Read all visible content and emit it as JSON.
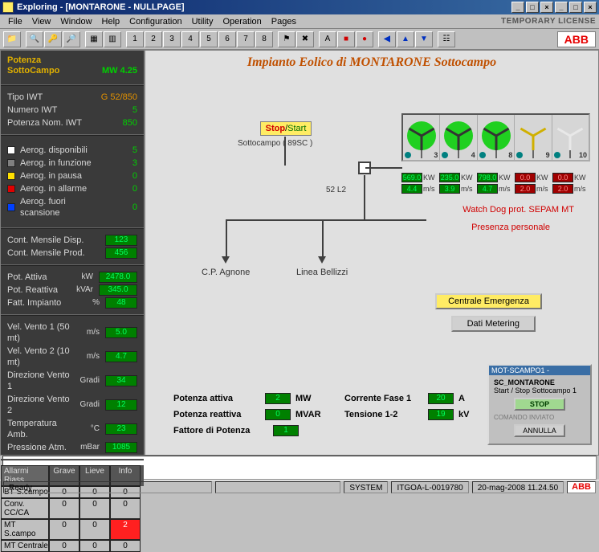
{
  "title_bar": "Exploring - [MONTARONE - NULLPAGE]",
  "menu": {
    "file": "File",
    "view": "View",
    "window": "Window",
    "help": "Help",
    "config": "Configuration",
    "utility": "Utility",
    "operation": "Operation",
    "pages": "Pages",
    "license": "TEMPORARY LICENSE"
  },
  "sidebar": {
    "header_line1": "Potenza",
    "header_line2": "SottoCampo",
    "header_value": "MW 4.25",
    "tipo_iwt_label": "Tipo IWT",
    "tipo_iwt_val": "G 52/850",
    "num_iwt_label": "Numero IWT",
    "num_iwt_val": "5",
    "potnom_label": "Potenza Nom. IWT",
    "potnom_val": "850",
    "status": [
      {
        "color": "#ffffff",
        "label": "Aerog. disponibili",
        "val": "5"
      },
      {
        "color": "#808080",
        "label": "Aerog. in funzione",
        "val": "3"
      },
      {
        "color": "#ffe000",
        "label": "Aerog. in pausa",
        "val": "0"
      },
      {
        "color": "#e00000",
        "label": "Aerog. in allarme",
        "val": "0"
      },
      {
        "color": "#0040ff",
        "label": "Aerog. fuori scansione",
        "val": "0"
      }
    ],
    "cont_disp_label": "Cont. Mensile Disp.",
    "cont_disp_val": "123",
    "cont_prod_label": "Cont. Mensile Prod.",
    "cont_prod_val": "456",
    "pot_attiva_label": "Pot. Attiva",
    "pot_attiva_unit": "kW",
    "pot_attiva_val": "2478.0",
    "pot_reattiva_label": "Pot. Reattiva",
    "pot_reattiva_unit": "kVAr",
    "pot_reattiva_val": "345.0",
    "fatt_label": "Fatt. Impianto",
    "fatt_unit": "%",
    "fatt_val": "48",
    "vv1_label": "Vel. Vento 1 (50 mt)",
    "vv1_unit": "m/s",
    "vv1_val": "5.0",
    "vv2_label": "Vel. Vento 2 (10 mt)",
    "vv2_unit": "m/s",
    "vv2_val": "4.7",
    "dv1_label": "Direzione Vento 1",
    "dv1_unit": "Gradi",
    "dv1_val": "34",
    "dv2_label": "Direzione Vento 2",
    "dv2_unit": "Gradi",
    "dv2_val": "12",
    "tamb_label": "Temperatura Amb.",
    "tamb_unit": "°C",
    "tamb_val": "23",
    "patm_label": "Pressione Atm.",
    "patm_unit": "mBar",
    "patm_val": "1085",
    "alarm_hd": "Allarmi Riass.",
    "alarm_c1": "Grave",
    "alarm_c2": "Lieve",
    "alarm_c3": "Info",
    "alarms": [
      {
        "name": "BT S.campo",
        "g": "0",
        "l": "0",
        "i": "0"
      },
      {
        "name": "Conv. CC/CA",
        "g": "0",
        "l": "0",
        "i": "0"
      },
      {
        "name": "MT S.campo",
        "g": "0",
        "l": "0",
        "i": "2",
        "ired": true
      },
      {
        "name": "MT Centrale",
        "g": "0",
        "l": "0",
        "i": "0"
      }
    ]
  },
  "canvas": {
    "title": "Impianto Eolico di MONTARONE Sottocampo",
    "stop": "Stop",
    "start": "Start",
    "sublabel": "Sottocampo ( 89SC )",
    "breaker": "52 L2",
    "left_dest": "C.P. Agnone",
    "right_dest": "Linea Bellizzi",
    "watchdog": "Watch Dog prot. SEPAM MT",
    "presenza": "Presenza personale",
    "btn_emerg": "Centrale Emergenza",
    "btn_dati": "Dati Metering",
    "turb_nums": [
      "3",
      "4",
      "8",
      "9",
      "10"
    ],
    "kw": [
      "569.0",
      "235.0",
      "798.0",
      "0.0",
      "0.0"
    ],
    "kw_red": [
      false,
      false,
      false,
      true,
      true
    ],
    "ms": [
      "4.4",
      "3.9",
      "4.7",
      "2.0",
      "2.0"
    ],
    "ms_red": [
      false,
      false,
      false,
      true,
      true
    ],
    "kw_lab": "KW",
    "ms_lab": "m/s",
    "meas": {
      "pa_label": "Potenza attiva",
      "pa_val": "2",
      "pa_unit": "MW",
      "pr_label": "Potenza reattiva",
      "pr_val": "0",
      "pr_unit": "MVAR",
      "fp_label": "Fattore di Potenza",
      "fp_val": "1",
      "cf_label": "Corrente Fase 1",
      "cf_val": "20",
      "cf_unit": "A",
      "t12_label": "Tensione 1-2",
      "t12_val": "19",
      "t12_unit": "kV"
    },
    "popup": {
      "title": "MOT-SCAMPO1 -",
      "sub": "SC_MONTARONE",
      "desc": "Start / Stop Sottocampo 1",
      "stop": "STOP",
      "cmd": "COMANDO INVIATO",
      "annulla": "ANNULLA"
    }
  },
  "status": {
    "ready": "Ready",
    "system": "SYSTEM",
    "host": "ITGOA-L-0019780",
    "time": "20-mag-2008 11.24.50",
    "logo": "ABB"
  }
}
